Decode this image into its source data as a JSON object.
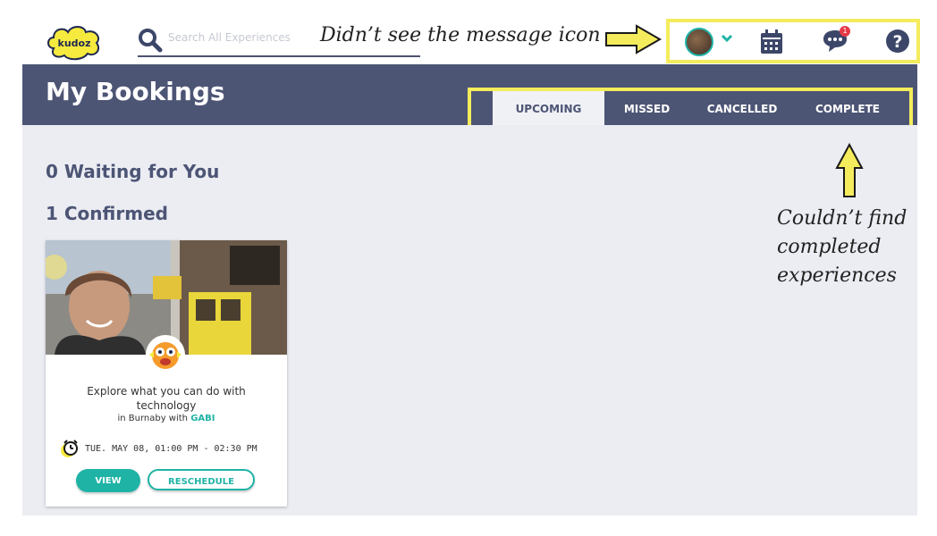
{
  "app": {
    "logo_text": "kudoz"
  },
  "search": {
    "placeholder": "Search All Experiences"
  },
  "annotations": {
    "message_icon_note": "Didn’t see the message icon",
    "completed_note_lines": [
      "Couldn’t find",
      "completed",
      "experiences"
    ]
  },
  "header_icons": {
    "avatar": "user-avatar",
    "calendar": "calendar-icon",
    "messages": "chat-bubble-icon",
    "messages_badge": "1",
    "help": "question-mark-icon"
  },
  "page": {
    "title": "My Bookings"
  },
  "tabs": [
    {
      "label": "UPCOMING",
      "active": true
    },
    {
      "label": "MISSED",
      "active": false
    },
    {
      "label": "CANCELLED",
      "active": false
    },
    {
      "label": "COMPLETE",
      "active": false
    }
  ],
  "sections": {
    "waiting": "0 Waiting for You",
    "confirmed": "1 Confirmed"
  },
  "booking_card": {
    "title": "Explore what you can do with technology",
    "location_prefix": "in Burnaby with",
    "host": "GABI",
    "datetime": "TUE. MAY 08, 01:00 PM - 02:30 PM",
    "view_label": "VIEW",
    "reschedule_label": "RESCHEDULE"
  },
  "colors": {
    "header_bg": "#4d5575",
    "accent_teal": "#1fb3a6",
    "highlight_yellow": "#f4ec5c",
    "content_bg": "#ebedf3",
    "badge_red": "#e63946"
  }
}
